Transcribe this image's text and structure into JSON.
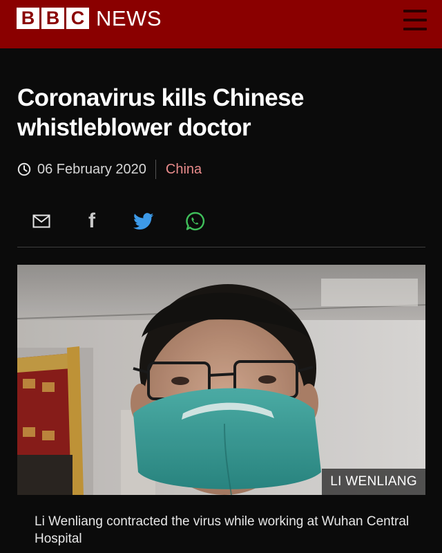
{
  "header": {
    "logo_letters": [
      "B",
      "B",
      "C"
    ],
    "logo_text": "NEWS",
    "brand_color": "#8a0000",
    "menu_icon": "hamburger-menu-icon"
  },
  "article": {
    "headline": "Coronavirus kills Chinese whistleblower doctor",
    "date": "06 February 2020",
    "section": "China",
    "section_color": "#e88b8b"
  },
  "share": {
    "icons": [
      "email-icon",
      "facebook-icon",
      "twitter-icon",
      "whatsapp-icon"
    ],
    "facebook_glyph": "f"
  },
  "image": {
    "credit": "LI WENLIANG",
    "caption": "Li Wenliang contracted the virus while working at Wuhan Central Hospital"
  }
}
